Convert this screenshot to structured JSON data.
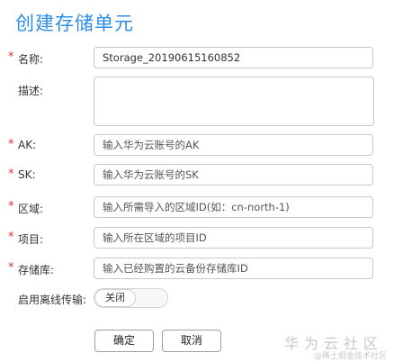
{
  "page": {
    "title": "创建存储单元"
  },
  "form": {
    "name": {
      "label": "名称:",
      "value": "Storage_20190615160852",
      "required": true
    },
    "desc": {
      "label": "描述:",
      "value": "",
      "required": false
    },
    "ak": {
      "label": "AK:",
      "placeholder": "输入华为云账号的AK",
      "required": true
    },
    "sk": {
      "label": "SK:",
      "placeholder": "输入华为云账号的SK",
      "required": true
    },
    "region": {
      "label": "区域:",
      "placeholder": "输入所需导入的区域ID(如：cn-north-1)",
      "required": true
    },
    "project": {
      "label": "项目:",
      "placeholder": "输入所在区域的项目ID",
      "required": true
    },
    "repo": {
      "label": "存储库:",
      "placeholder": "输入已经购置的云备份存储库ID",
      "required": true
    },
    "offline": {
      "label": "启用离线传输:",
      "state": "关闭"
    }
  },
  "buttons": {
    "ok": "确定",
    "cancel": "取消"
  },
  "watermark": {
    "text": "华为云社区",
    "sub": "@稀土掘金技术社区"
  },
  "required_mark": "*"
}
